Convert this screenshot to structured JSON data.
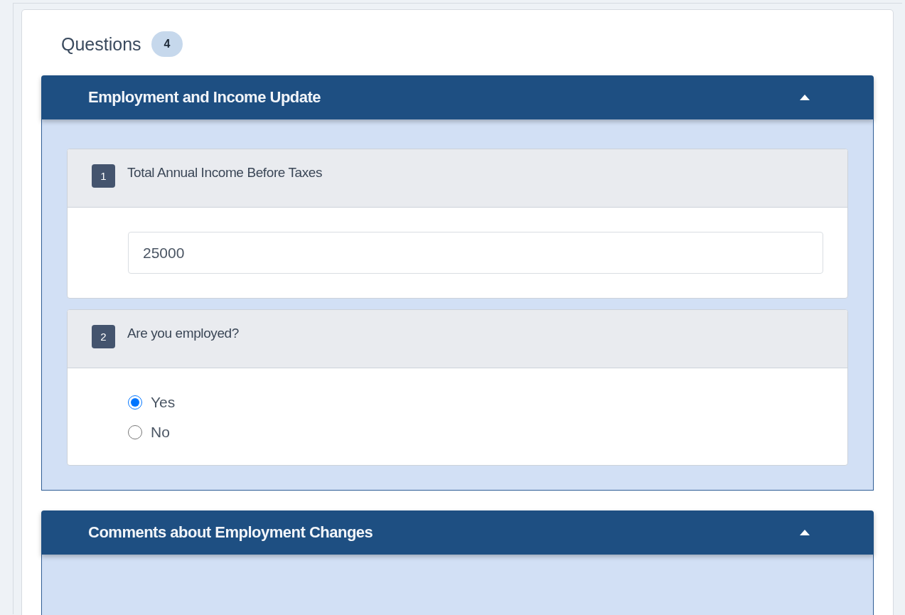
{
  "header": {
    "title": "Questions",
    "count": "4"
  },
  "sections": [
    {
      "title": "Employment and Income Update",
      "expanded": true,
      "questions": [
        {
          "number": "1",
          "text": "Total Annual Income Before Taxes",
          "kind": "text",
          "value": "25000"
        },
        {
          "number": "2",
          "text": "Are you employed?",
          "kind": "radio",
          "options": [
            {
              "label": "Yes",
              "selected": true
            },
            {
              "label": "No",
              "selected": false
            }
          ]
        }
      ]
    },
    {
      "title": "Comments about Employment Changes",
      "expanded": true
    }
  ]
}
